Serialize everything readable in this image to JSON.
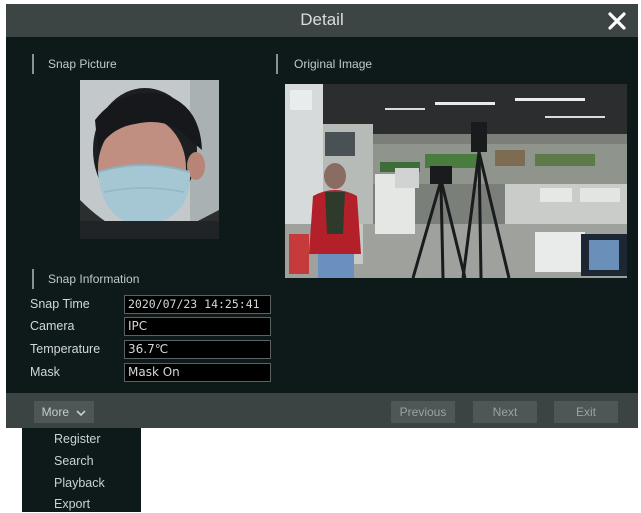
{
  "dialog": {
    "title": "Detail"
  },
  "snap_picture": {
    "heading": "Snap Picture"
  },
  "original_image": {
    "heading": "Original Image"
  },
  "snap_information": {
    "heading": "Snap Information",
    "rows": [
      {
        "label": "Snap Time",
        "value": "2020/07/23 14:25:41"
      },
      {
        "label": "Camera",
        "value": "IPC"
      },
      {
        "label": "Temperature",
        "value": "36.7℃"
      },
      {
        "label": "Mask",
        "value": "Mask On"
      }
    ]
  },
  "footer": {
    "more_label": "More",
    "previous_label": "Previous",
    "next_label": "Next",
    "exit_label": "Exit"
  },
  "more_menu": {
    "items": [
      "Register",
      "Search",
      "Playback",
      "Export"
    ]
  },
  "colors": {
    "dialog_bg": "#0e1a1a",
    "titlebar_bg": "#3d4444",
    "field_bg": "#000000",
    "shirt_red": "#b3202a"
  }
}
